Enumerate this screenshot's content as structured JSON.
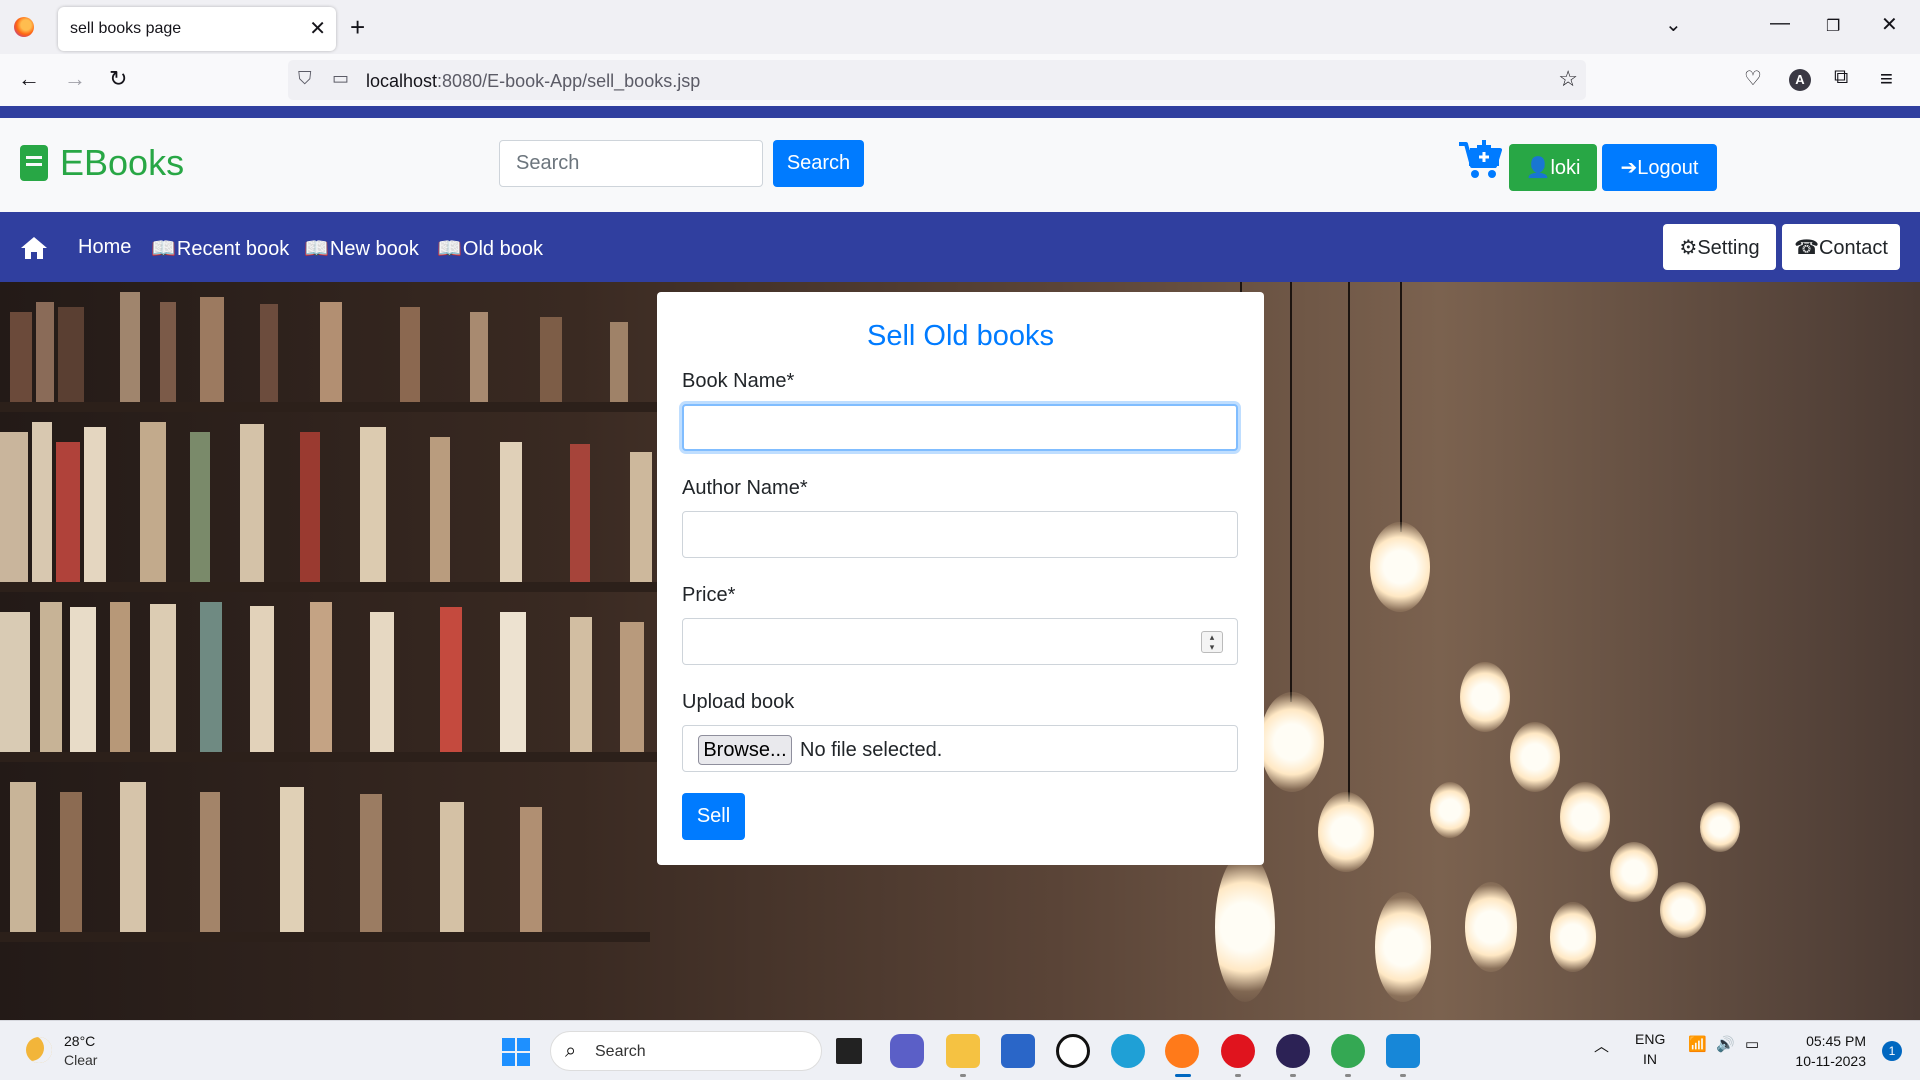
{
  "browser": {
    "tab_title": "sell books page",
    "url_host": "localhost",
    "url_rest": ":8080/E-book-App/sell_books.jsp",
    "account_initial": "A"
  },
  "header": {
    "brand": "EBooks",
    "search_placeholder": "Search",
    "search_button": "Search",
    "user_button": "loki",
    "logout_button": "Logout"
  },
  "nav": {
    "home": "Home",
    "recent": "Recent book",
    "new": "New book",
    "old": "Old book",
    "setting": "Setting",
    "contact": "Contact"
  },
  "form": {
    "title": "Sell Old books",
    "book_name_label": "Book Name*",
    "author_name_label": "Author Name*",
    "price_label": "Price*",
    "upload_label": "Upload book",
    "browse_button": "Browse...",
    "file_status": "No file selected.",
    "submit_button": "Sell"
  },
  "taskbar": {
    "temperature": "28°C",
    "condition": "Clear",
    "search_placeholder": "Search",
    "lang": "ENG",
    "region": "IN",
    "time": "05:45 PM",
    "date": "10-11-2023",
    "notification_count": "1"
  },
  "colors": {
    "primary": "#007bff",
    "success": "#28a745",
    "navbar": "#303f9f"
  }
}
